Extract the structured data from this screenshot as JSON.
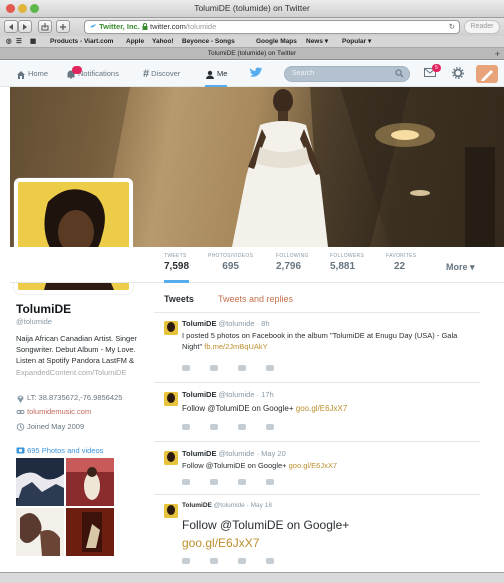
{
  "browser": {
    "window_title": "TolumiDE (tolumide) on Twitter",
    "tab_title": "TolumiDE (tolumide) on Twitter",
    "address": {
      "cert": "Twitter, Inc.",
      "domain": "twitter.com",
      "path": "/tolumide"
    },
    "reader_label": "Reader",
    "bookmarks": [
      "Products - Viart.com",
      "Apple",
      "Yahoo!",
      "Beyonce - Songs",
      "Google Maps",
      "News ▾",
      "Popular ▾"
    ]
  },
  "nav": {
    "home": "Home",
    "notifications": "Notifications",
    "discover": "Discover",
    "me": "Me",
    "search_placeholder": "Search",
    "messages_count": "5",
    "accent": "#55acee"
  },
  "profile": {
    "name": "TolumiDE",
    "handle": "@tolumide",
    "bio": "Naija African Canadian Artist. Singer Songwriter. Debut Album - My Love. Listen at Spotify Pandora LastFM &",
    "bio_link": "ExpandedContent.com/TolumiDE",
    "location": "LT: 38.8735672,-76.9856425",
    "website": "tolumidemusic.com",
    "joined": "Joined May 2009",
    "photos_label": "695 Photos and videos"
  },
  "stats": [
    {
      "label": "TWEETS",
      "value": "7,598"
    },
    {
      "label": "PHOTOS/VIDEOS",
      "value": "695"
    },
    {
      "label": "FOLLOWING",
      "value": "2,796"
    },
    {
      "label": "FOLLOWERS",
      "value": "5,881"
    },
    {
      "label": "FAVORITES",
      "value": "22"
    }
  ],
  "more_label": "More ▾",
  "timeline": {
    "tabs": [
      "Tweets",
      "Tweets and replies"
    ],
    "tweets": [
      {
        "name": "TolumiDE",
        "handle": "@tolumide · 8h",
        "text": "I posted 5 photos on Facebook in the album \"TolumiDE at Enugu Day (USA) - Gala Night\"",
        "link": "fb.me/2JmBqUAkY"
      },
      {
        "name": "TolumiDE",
        "handle": "@tolumide · 17h",
        "text": "Follow @TolumiDE on Google+",
        "link": "goo.gl/E6JxX7"
      },
      {
        "name": "TolumiDE",
        "handle": "@tolumide · May 20",
        "text": "Follow @TolumiDE on Google+",
        "link": "goo.gl/E6JxX7"
      },
      {
        "name": "TolumiDE",
        "handle": "@tolumide · May 18",
        "text": "Follow @TolumiDE on Google+",
        "link": "goo.gl/E6JxX7"
      }
    ]
  }
}
